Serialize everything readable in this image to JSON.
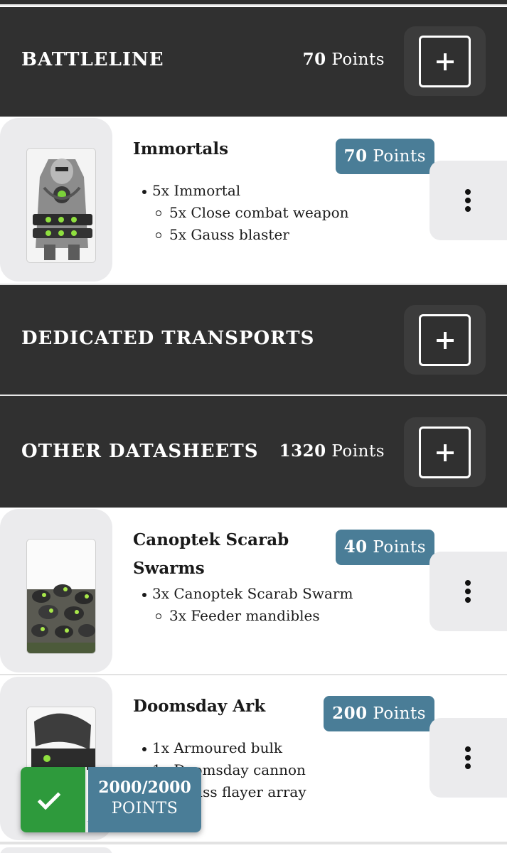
{
  "sections": [
    {
      "title": "BATTLELINE",
      "points_value": "70",
      "points_unit": "Points"
    },
    {
      "title": "DEDICATED TRANSPORTS"
    },
    {
      "title": "OTHER DATASHEETS",
      "points_value": "1320",
      "points_unit": "Points"
    }
  ],
  "units": [
    {
      "name": "Immortals",
      "points_value": "70",
      "points_unit": "Points",
      "wargear": [
        {
          "level": 1,
          "text": "5x Immortal"
        },
        {
          "level": 2,
          "text": "5x Close combat weapon"
        },
        {
          "level": 2,
          "text": "5x Gauss blaster"
        }
      ]
    },
    {
      "name": "Canoptek Scarab Swarms",
      "points_value": "40",
      "points_unit": "Points",
      "wargear": [
        {
          "level": 1,
          "text": "3x Canoptek Scarab Swarm"
        },
        {
          "level": 2,
          "text": "3x Feeder mandibles"
        }
      ]
    },
    {
      "name": "Doomsday Ark",
      "points_value": "200",
      "points_unit": "Points",
      "wargear": [
        {
          "level": 1,
          "text": "1x Armoured bulk"
        },
        {
          "level": 1,
          "text": "1x Doomsday cannon"
        },
        {
          "level": 1,
          "text": "2x Gauss flayer array"
        }
      ]
    }
  ],
  "total": {
    "count": "2000/2000",
    "label": "POINTS"
  },
  "colors": {
    "header_bg": "#303030",
    "badge_bg": "#4a7d97",
    "success": "#2e9a3c",
    "button_bg": "#ebebed"
  },
  "icons": {
    "add": "plus-icon",
    "menu": "more-vertical-icon",
    "total": "checkmark-icon"
  }
}
